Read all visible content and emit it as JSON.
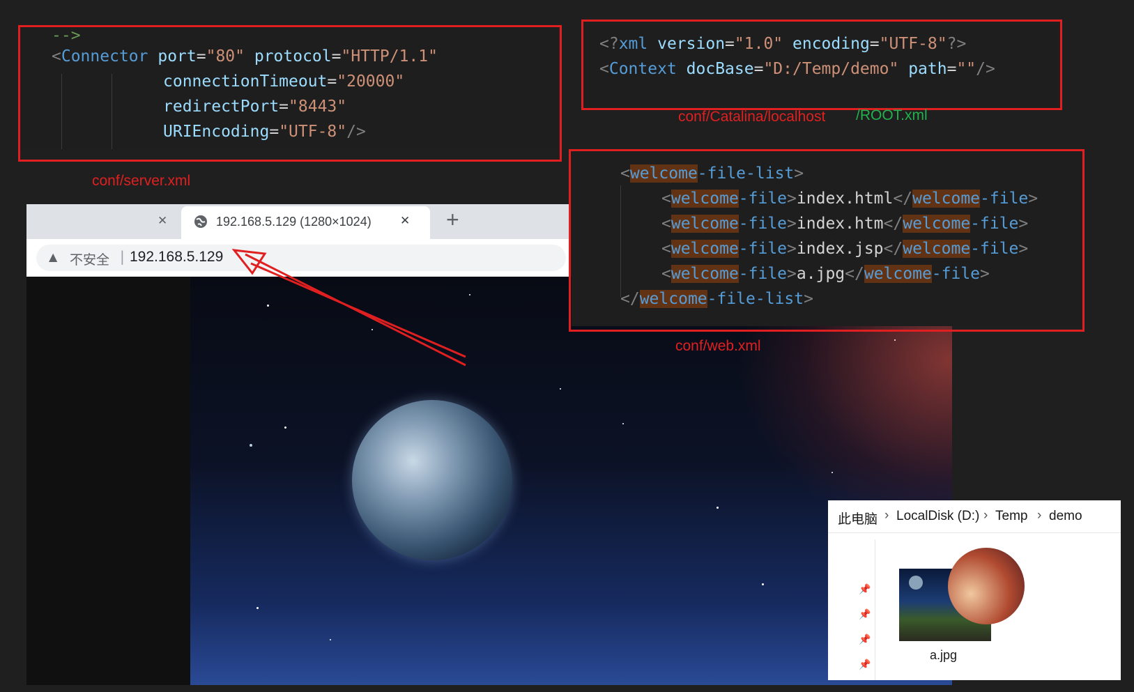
{
  "server_xml": {
    "lines": [
      {
        "text": "-->"
      },
      {
        "lt": "<",
        "tag": "Connector",
        "attr1": "port",
        "eq1": "=",
        "val1": "\"80\"",
        "attr2": "protocol",
        "eq2": "=",
        "val2": "\"HTTP/1.1\""
      },
      {
        "attr": "connectionTimeout",
        "eq": "=",
        "val": "\"20000\""
      },
      {
        "attr": "redirectPort",
        "eq": "=",
        "val": "\"8443\""
      },
      {
        "attr": "URIEncoding",
        "eq": "=",
        "val": "\"UTF-8\"",
        "close": "/>"
      }
    ],
    "label": "conf/server.xml"
  },
  "root_xml": {
    "line1": {
      "open": "<?",
      "tag": "xml",
      "attr1": "version",
      "eq1": "=",
      "val1": "\"1.0\"",
      "attr2": "encoding",
      "eq2": "=",
      "val2": "\"UTF-8\"",
      "close": "?>"
    },
    "line2": {
      "lt": "<",
      "tag": "Context",
      "attr1": "docBase",
      "eq1": "=",
      "val1": "\"D:/Temp/demo\"",
      "attr2": "path",
      "eq2": "=",
      "val2": "\"\"",
      "close": "/>"
    },
    "label_red": "conf/Catalina/localhost",
    "label_green": "/ROOT.xml"
  },
  "web_xml": {
    "list_open": {
      "lt": "<",
      "tag_a": "welcome",
      "tag_b": "-file-list",
      "gt": ">"
    },
    "files": [
      "index.html",
      "index.htm",
      "index.jsp",
      "a.jpg"
    ],
    "file_tag_a": "welcome",
    "file_tag_b": "-file",
    "list_close": {
      "lt": "</",
      "tag_a": "welcome",
      "tag_b": "-file-list",
      "gt": ">"
    },
    "label": "conf/web.xml"
  },
  "browser": {
    "tab_title": "192.168.5.129 (1280×1024)",
    "prev_tab_close": "✕",
    "tab_close": "✕",
    "new_tab": "+",
    "warning_icon": "▲",
    "not_secure": "不安全",
    "separator": "|",
    "url": "192.168.5.129"
  },
  "explorer": {
    "breadcrumb": [
      "此电脑",
      "LocalDisk (D:)",
      "Temp",
      "demo"
    ],
    "chevron": "›",
    "pin_icon": "📌",
    "file_name": "a.jpg"
  },
  "colors": {
    "annotation_red": "#e02020",
    "annotation_green": "#22b14c",
    "tag_blue": "#569cd6",
    "attr_blue": "#9cdcfe",
    "string_orange": "#ce9178"
  }
}
